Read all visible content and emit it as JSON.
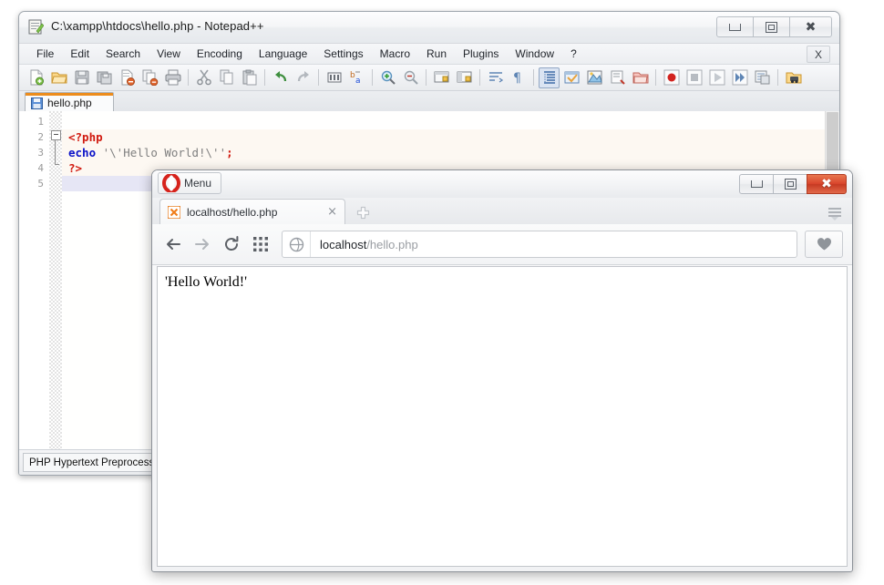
{
  "editor_window": {
    "title": "C:\\xampp\\htdocs\\hello.php - Notepad++",
    "title_icon": "notepad-plus-plus-icon",
    "window_buttons": {
      "minimize": "–",
      "restore": "❐",
      "close": "✕"
    },
    "menu": [
      "File",
      "Edit",
      "Search",
      "View",
      "Encoding",
      "Language",
      "Settings",
      "Macro",
      "Run",
      "Plugins",
      "Window",
      "?"
    ],
    "document_close_label": "X",
    "toolbar": [
      "new-file-icon",
      "open-file-icon",
      "save-icon",
      "save-all-icon",
      "close-file-icon",
      "close-all-icon",
      "print-icon",
      "SEP",
      "cut-icon",
      "copy-icon",
      "paste-icon",
      "SEP",
      "undo-icon",
      "redo-icon",
      "SEP",
      "find-icon",
      "replace-icon",
      "SEP",
      "zoom-in-icon",
      "zoom-out-icon",
      "SEP",
      "sync-vertical-icon",
      "sync-horizontal-icon",
      "SEP",
      "word-wrap-icon",
      "show-all-chars-icon",
      "SEP",
      "indent-guide-icon",
      "user-defined-dialog-icon",
      "document-map-icon",
      "function-list-icon",
      "folder-as-workspace-icon",
      "SEP",
      "record-macro-icon",
      "stop-macro-icon",
      "play-macro-icon",
      "run-macro-multiple-icon",
      "save-macro-icon",
      "SEP",
      "run-icon"
    ],
    "tab": {
      "label": "hello.php",
      "icon": "saved-file-icon"
    },
    "line_numbers": [
      "1",
      "2",
      "3",
      "4",
      "5"
    ],
    "code_lines": [
      {
        "n": 1,
        "tokens": []
      },
      {
        "n": 2,
        "tokens": [
          {
            "t": "<?php",
            "c": "tag"
          }
        ]
      },
      {
        "n": 3,
        "tokens": [
          {
            "t": "echo",
            "c": "kw"
          },
          {
            "t": " '\\'Hello World!\\''",
            "c": "str"
          },
          {
            "t": ";",
            "c": "semi"
          }
        ]
      },
      {
        "n": 4,
        "tokens": [
          {
            "t": "?>",
            "c": "tag"
          }
        ]
      },
      {
        "n": 5,
        "tokens": []
      }
    ],
    "status_bar": {
      "language": "PHP Hypertext Preprocess"
    }
  },
  "browser_window": {
    "menu_button": {
      "label": "Menu",
      "icon": "opera-logo-icon"
    },
    "window_buttons": {
      "minimize": "–",
      "restore": "❐",
      "close": "✕"
    },
    "tab": {
      "title": "localhost/hello.php",
      "favicon": "xampp-favicon",
      "close_label": "×"
    },
    "new_tab_label": "+",
    "nav": {
      "back_icon": "arrow-left-icon",
      "forward_icon": "arrow-right-icon",
      "reload_icon": "reload-icon",
      "speed_dial_icon": "speed-dial-grid-icon",
      "badge_icon": "globe-icon",
      "heart_icon": "heart-bookmark-icon",
      "sidebar_icon": "sidebar-toggle-icon"
    },
    "url": {
      "host": "localhost",
      "path": "/hello.php"
    },
    "page_content": "'Hello World!'"
  },
  "colors": {
    "php_tag": "#d11a0f",
    "php_keyword": "#0a12c8",
    "php_string": "#808080",
    "tab_accent": "#ec8c1c",
    "opera_red": "#d9452c",
    "current_line": "#e6e6f5"
  }
}
